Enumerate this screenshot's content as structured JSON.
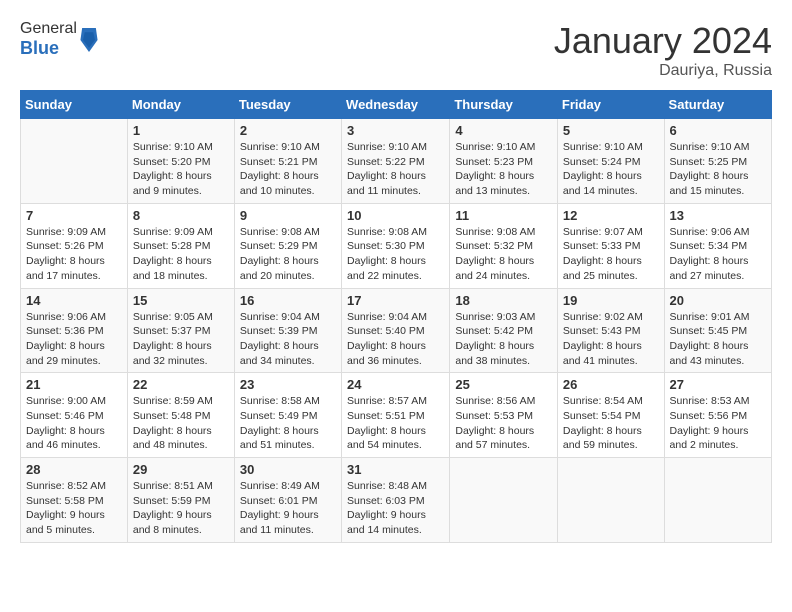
{
  "header": {
    "logo_general": "General",
    "logo_blue": "Blue",
    "month_year": "January 2024",
    "location": "Dauriya, Russia"
  },
  "weekdays": [
    "Sunday",
    "Monday",
    "Tuesday",
    "Wednesday",
    "Thursday",
    "Friday",
    "Saturday"
  ],
  "weeks": [
    [
      {
        "day": "",
        "info": ""
      },
      {
        "day": "1",
        "info": "Sunrise: 9:10 AM\nSunset: 5:20 PM\nDaylight: 8 hours\nand 9 minutes."
      },
      {
        "day": "2",
        "info": "Sunrise: 9:10 AM\nSunset: 5:21 PM\nDaylight: 8 hours\nand 10 minutes."
      },
      {
        "day": "3",
        "info": "Sunrise: 9:10 AM\nSunset: 5:22 PM\nDaylight: 8 hours\nand 11 minutes."
      },
      {
        "day": "4",
        "info": "Sunrise: 9:10 AM\nSunset: 5:23 PM\nDaylight: 8 hours\nand 13 minutes."
      },
      {
        "day": "5",
        "info": "Sunrise: 9:10 AM\nSunset: 5:24 PM\nDaylight: 8 hours\nand 14 minutes."
      },
      {
        "day": "6",
        "info": "Sunrise: 9:10 AM\nSunset: 5:25 PM\nDaylight: 8 hours\nand 15 minutes."
      }
    ],
    [
      {
        "day": "7",
        "info": "Sunrise: 9:09 AM\nSunset: 5:26 PM\nDaylight: 8 hours\nand 17 minutes."
      },
      {
        "day": "8",
        "info": "Sunrise: 9:09 AM\nSunset: 5:28 PM\nDaylight: 8 hours\nand 18 minutes."
      },
      {
        "day": "9",
        "info": "Sunrise: 9:08 AM\nSunset: 5:29 PM\nDaylight: 8 hours\nand 20 minutes."
      },
      {
        "day": "10",
        "info": "Sunrise: 9:08 AM\nSunset: 5:30 PM\nDaylight: 8 hours\nand 22 minutes."
      },
      {
        "day": "11",
        "info": "Sunrise: 9:08 AM\nSunset: 5:32 PM\nDaylight: 8 hours\nand 24 minutes."
      },
      {
        "day": "12",
        "info": "Sunrise: 9:07 AM\nSunset: 5:33 PM\nDaylight: 8 hours\nand 25 minutes."
      },
      {
        "day": "13",
        "info": "Sunrise: 9:06 AM\nSunset: 5:34 PM\nDaylight: 8 hours\nand 27 minutes."
      }
    ],
    [
      {
        "day": "14",
        "info": "Sunrise: 9:06 AM\nSunset: 5:36 PM\nDaylight: 8 hours\nand 29 minutes."
      },
      {
        "day": "15",
        "info": "Sunrise: 9:05 AM\nSunset: 5:37 PM\nDaylight: 8 hours\nand 32 minutes."
      },
      {
        "day": "16",
        "info": "Sunrise: 9:04 AM\nSunset: 5:39 PM\nDaylight: 8 hours\nand 34 minutes."
      },
      {
        "day": "17",
        "info": "Sunrise: 9:04 AM\nSunset: 5:40 PM\nDaylight: 8 hours\nand 36 minutes."
      },
      {
        "day": "18",
        "info": "Sunrise: 9:03 AM\nSunset: 5:42 PM\nDaylight: 8 hours\nand 38 minutes."
      },
      {
        "day": "19",
        "info": "Sunrise: 9:02 AM\nSunset: 5:43 PM\nDaylight: 8 hours\nand 41 minutes."
      },
      {
        "day": "20",
        "info": "Sunrise: 9:01 AM\nSunset: 5:45 PM\nDaylight: 8 hours\nand 43 minutes."
      }
    ],
    [
      {
        "day": "21",
        "info": "Sunrise: 9:00 AM\nSunset: 5:46 PM\nDaylight: 8 hours\nand 46 minutes."
      },
      {
        "day": "22",
        "info": "Sunrise: 8:59 AM\nSunset: 5:48 PM\nDaylight: 8 hours\nand 48 minutes."
      },
      {
        "day": "23",
        "info": "Sunrise: 8:58 AM\nSunset: 5:49 PM\nDaylight: 8 hours\nand 51 minutes."
      },
      {
        "day": "24",
        "info": "Sunrise: 8:57 AM\nSunset: 5:51 PM\nDaylight: 8 hours\nand 54 minutes."
      },
      {
        "day": "25",
        "info": "Sunrise: 8:56 AM\nSunset: 5:53 PM\nDaylight: 8 hours\nand 57 minutes."
      },
      {
        "day": "26",
        "info": "Sunrise: 8:54 AM\nSunset: 5:54 PM\nDaylight: 8 hours\nand 59 minutes."
      },
      {
        "day": "27",
        "info": "Sunrise: 8:53 AM\nSunset: 5:56 PM\nDaylight: 9 hours\nand 2 minutes."
      }
    ],
    [
      {
        "day": "28",
        "info": "Sunrise: 8:52 AM\nSunset: 5:58 PM\nDaylight: 9 hours\nand 5 minutes."
      },
      {
        "day": "29",
        "info": "Sunrise: 8:51 AM\nSunset: 5:59 PM\nDaylight: 9 hours\nand 8 minutes."
      },
      {
        "day": "30",
        "info": "Sunrise: 8:49 AM\nSunset: 6:01 PM\nDaylight: 9 hours\nand 11 minutes."
      },
      {
        "day": "31",
        "info": "Sunrise: 8:48 AM\nSunset: 6:03 PM\nDaylight: 9 hours\nand 14 minutes."
      },
      {
        "day": "",
        "info": ""
      },
      {
        "day": "",
        "info": ""
      },
      {
        "day": "",
        "info": ""
      }
    ]
  ]
}
